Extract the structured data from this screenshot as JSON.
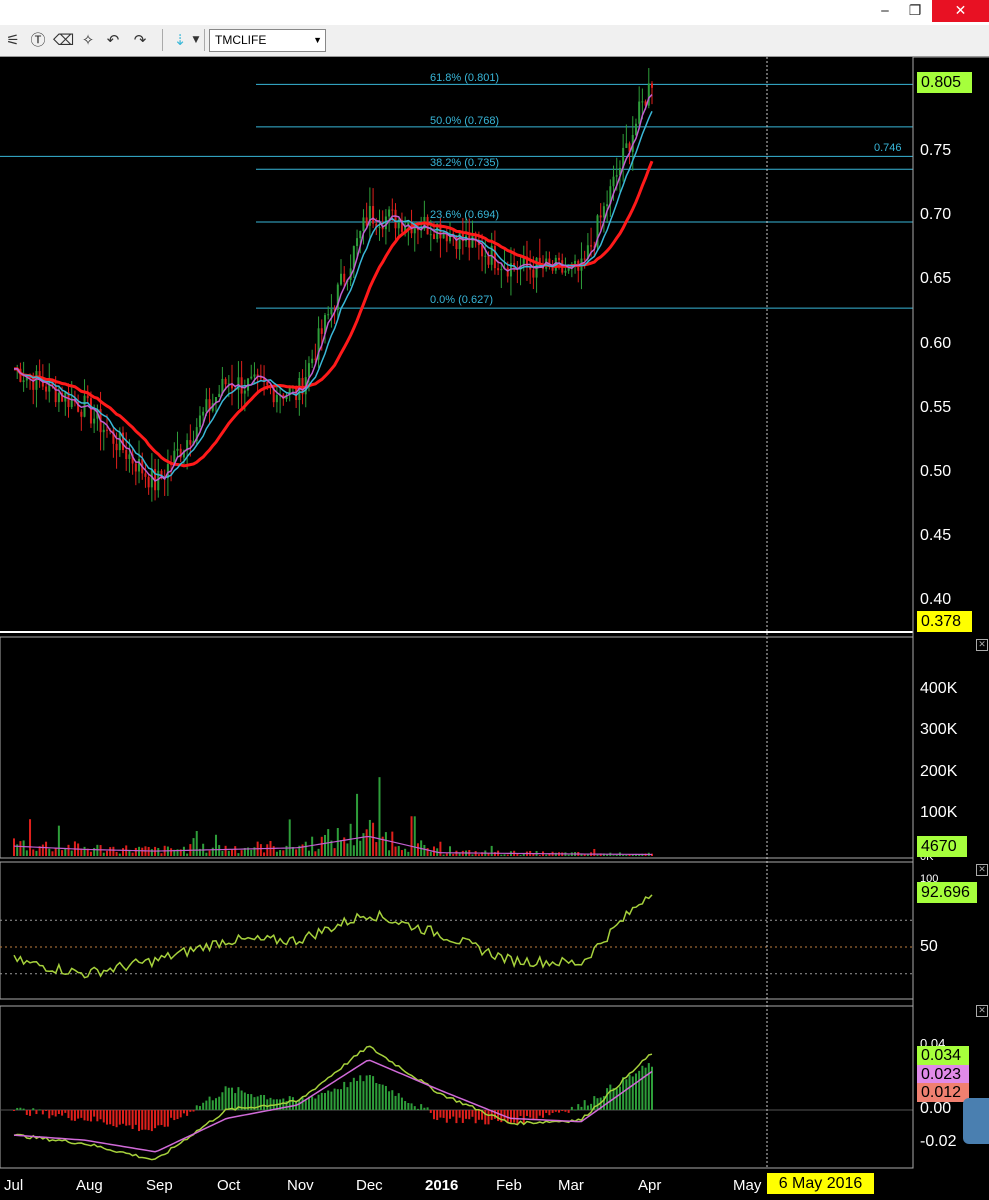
{
  "window": {
    "minimize": "‒",
    "restore": "❐",
    "close": "✕"
  },
  "toolbar": {
    "symbol": "TMCLIFE"
  },
  "price_axis": {
    "ticks": [
      "0.75",
      "0.70",
      "0.65",
      "0.60",
      "0.55",
      "0.50",
      "0.45",
      "0.40"
    ],
    "last_price": "0.805",
    "cursor_price": "0.378",
    "line_value": "0.746"
  },
  "fibonacci": [
    {
      "label": "61.8% (0.801)",
      "value": 0.801
    },
    {
      "label": "50.0% (0.768)",
      "value": 0.768
    },
    {
      "label": "38.2% (0.735)",
      "value": 0.735
    },
    {
      "label": "23.6% (0.694)",
      "value": 0.694
    },
    {
      "label": "0.0% (0.627)",
      "value": 0.627
    }
  ],
  "volume_axis": {
    "ticks": [
      "400K",
      "300K",
      "200K",
      "100K",
      "0K"
    ],
    "last": "4670"
  },
  "rsi_axis": {
    "ticks": [
      "100",
      "50"
    ],
    "last": "92.696"
  },
  "macd_axis": {
    "ticks": [
      "0.04",
      "0.00",
      "-0.02"
    ],
    "macd": "0.034",
    "signal": "0.023",
    "hist": "0.012"
  },
  "months": [
    "Jul",
    "Aug",
    "Sep",
    "Oct",
    "Nov",
    "Dec",
    "2016",
    "Feb",
    "Mar",
    "Apr",
    "May"
  ],
  "cursor_date": "6 May 2016",
  "colors": {
    "up": "#2e9e3a",
    "down": "#e0201c",
    "ma_red": "#ff1a1a",
    "ma_cyan": "#3ab8d8",
    "ma_purple": "#c15fd0",
    "fib": "#38b6d8",
    "rsi": "#a6d13c",
    "macd": "#a6d13c",
    "signal": "#d06ad8",
    "last_green": "#a6ff3c"
  },
  "chart_data": {
    "type": "line",
    "x": [
      "2015-07",
      "2015-08",
      "2015-09",
      "2015-10",
      "2015-11",
      "2015-12",
      "2016-01",
      "2016-02",
      "2016-03",
      "2016-04"
    ],
    "price_close": [
      0.58,
      0.55,
      0.49,
      0.57,
      0.56,
      0.7,
      0.69,
      0.66,
      0.655,
      0.805
    ],
    "volume": [
      30000,
      20000,
      15000,
      20000,
      25000,
      60000,
      10000,
      8000,
      6000,
      4670
    ],
    "rsi": [
      40,
      30,
      40,
      55,
      55,
      75,
      60,
      40,
      38,
      92.696
    ],
    "macd": [
      -0.015,
      -0.02,
      -0.03,
      0.0,
      0.005,
      0.038,
      0.01,
      -0.008,
      -0.006,
      0.034
    ],
    "signal": [
      -0.015,
      -0.018,
      -0.025,
      -0.005,
      0.003,
      0.03,
      0.012,
      -0.005,
      -0.007,
      0.023
    ],
    "fib_levels": [
      0.801,
      0.768,
      0.735,
      0.694,
      0.627
    ],
    "ylim": [
      0.4,
      0.81
    ]
  }
}
